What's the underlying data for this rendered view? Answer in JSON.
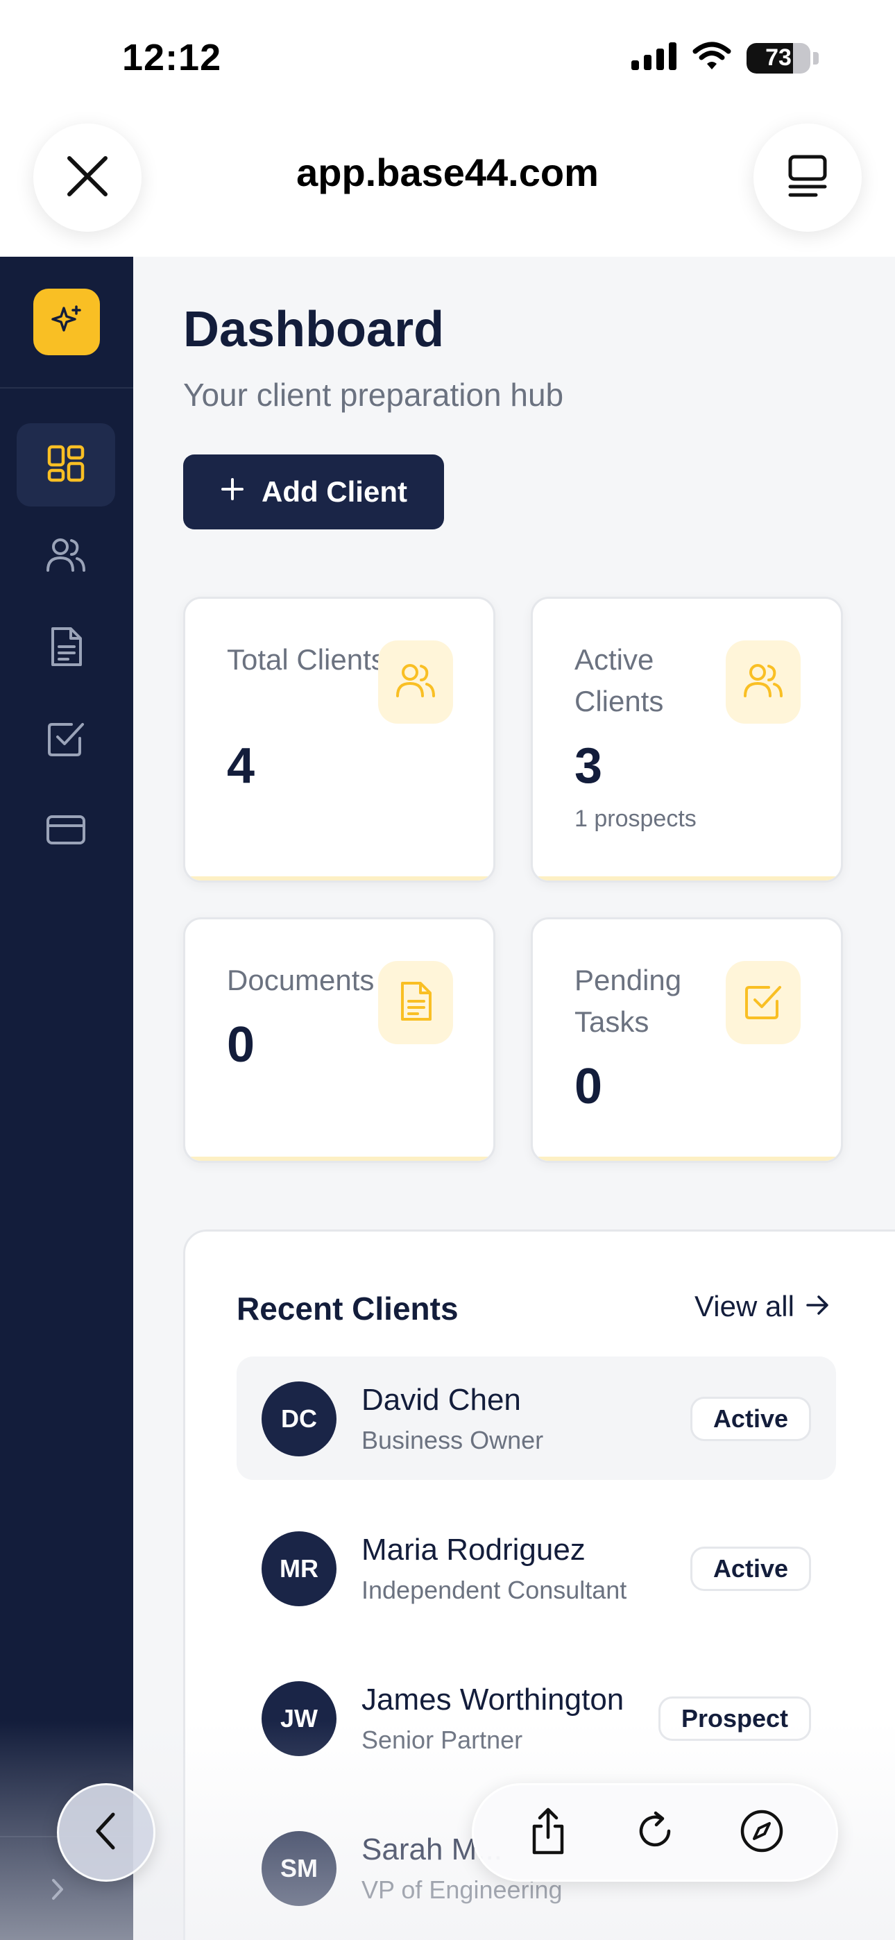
{
  "status_bar": {
    "time": "12:12",
    "battery_level": "73",
    "icons": [
      "signal-icon",
      "wifi-icon",
      "battery-icon"
    ]
  },
  "browser": {
    "url": "app.base44.com",
    "close_icon": "close-icon",
    "tabs_icon": "tabs-icon"
  },
  "sidebar": {
    "logo_icon": "sparkles-icon",
    "items": [
      {
        "icon": "dashboard-icon",
        "active": true
      },
      {
        "icon": "users-icon",
        "active": false
      },
      {
        "icon": "document-icon",
        "active": false
      },
      {
        "icon": "checkbox-icon",
        "active": false
      },
      {
        "icon": "credit-card-icon",
        "active": false
      }
    ],
    "expand_icon": "chevron-right-icon"
  },
  "dashboard": {
    "title": "Dashboard",
    "subtitle": "Your client preparation hub",
    "add_client_label": "Add Client",
    "stats": [
      {
        "label": "Total Clients",
        "value": "4",
        "note": "",
        "icon": "users-icon"
      },
      {
        "label": "Active Clients",
        "value": "3",
        "note": "1 prospects",
        "icon": "users-icon"
      },
      {
        "label": "Documents",
        "value": "0",
        "note": "",
        "icon": "document-icon"
      },
      {
        "label": "Pending Tasks",
        "value": "0",
        "note": "",
        "icon": "checkbox-icon"
      }
    ]
  },
  "recent_clients": {
    "title": "Recent Clients",
    "view_all_label": "View all",
    "clients": [
      {
        "initials": "DC",
        "name": "David Chen",
        "role": "Business Owner",
        "status": "Active"
      },
      {
        "initials": "MR",
        "name": "Maria Rodriguez",
        "role": "Independent Consultant",
        "status": "Active"
      },
      {
        "initials": "JW",
        "name": "James Worthington",
        "role": "Senior Partner",
        "status": "Prospect"
      },
      {
        "initials": "SM",
        "name": "Sarah M...",
        "role": "VP of Engineering",
        "status": ""
      }
    ]
  },
  "browser_toolbar": {
    "back_icon": "chevron-left-icon",
    "share_icon": "share-icon",
    "reload_icon": "reload-icon",
    "compass_icon": "compass-icon"
  },
  "colors": {
    "navy": "#131d3b",
    "button_navy": "#1a2547",
    "accent_yellow": "#f9bf24",
    "icon_bg_yellow": "#fff5d9",
    "muted_text": "#6b7280",
    "page_bg": "#f5f6f8"
  }
}
